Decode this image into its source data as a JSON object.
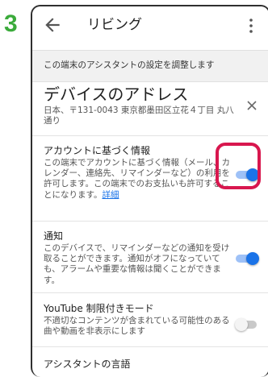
{
  "step": "3",
  "appbar": {
    "title": "リビング",
    "back_icon": "arrow-back-icon",
    "more_icon": "more-vert-icon"
  },
  "subheader": "この端末のアシスタントの設定を調整します",
  "address": {
    "title": "デバイスのアドレス",
    "description": "日本、〒131-0043 東京都墨田区立花４丁目 丸八通り",
    "close_icon": "close-icon"
  },
  "settings": [
    {
      "title": "アカウントに基づく情報",
      "description": "この端末でアカウントに基づく情報（メール、カレンダー、連絡先、リマインダーなど）の利用を許可します。この端末でのお支払いも許可することになります。",
      "link": "詳細",
      "enabled": true
    },
    {
      "title": "通知",
      "description": "このデバイスで、リマインダーなどの通知を受け取ることができます。通知がオフになっていても、アラームや重要な情報は聞くことができます。",
      "enabled": true
    },
    {
      "title": "YouTube 制限付きモード",
      "description": "不適切なコンテンツが含まれている可能性のある曲や動画を非表示にします",
      "enabled": false
    },
    {
      "title": "アシスタントの言語"
    }
  ],
  "colors": {
    "accent": "#1a73e8",
    "highlight": "#d8174e",
    "step": "#3bab3b"
  }
}
